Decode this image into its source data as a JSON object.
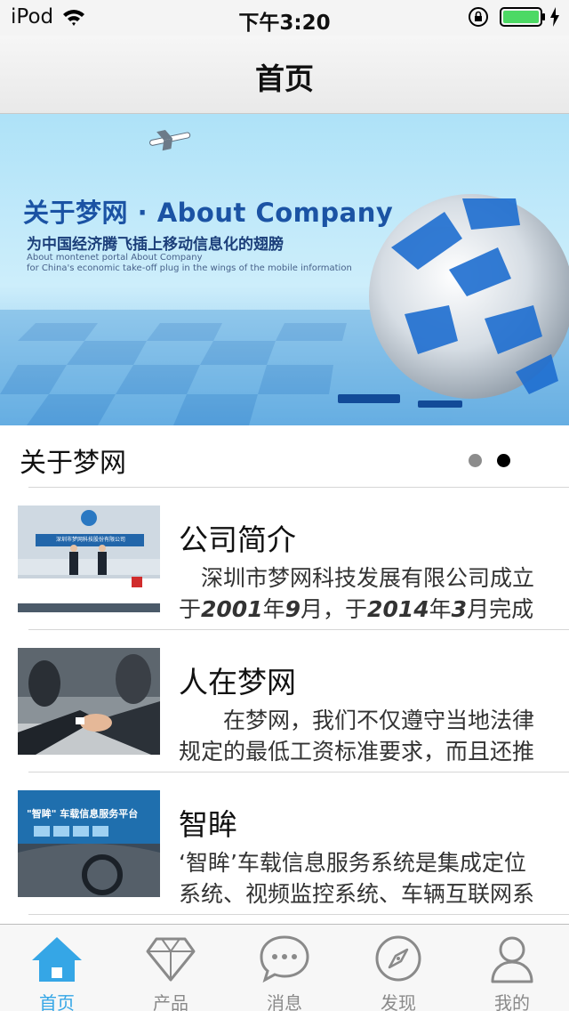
{
  "status_bar": {
    "carrier": "iPod",
    "time": "下午3:20"
  },
  "nav": {
    "title": "首页"
  },
  "banner": {
    "title": "关于梦网 · About Company",
    "subtitle": "为中国经济腾飞插上移动信息化的翅膀",
    "small_line_1": "About montenet portal About Company",
    "small_line_2": "for China's economic take-off plug in the wings of the mobile information",
    "page_count": 2,
    "active_page": 2
  },
  "section": {
    "title": "关于梦网"
  },
  "list": [
    {
      "title": "公司简介",
      "desc_line_1": "　深圳市梦网科技发展有限公司成立",
      "desc_line_2_parts": [
        "于",
        "2001",
        "年",
        "9",
        "月，于",
        "2014",
        "年",
        "3",
        "月完成股"
      ]
    },
    {
      "title": "人在梦网",
      "desc_line_1": "　　在梦网，我们不仅遵守当地法律",
      "desc_line_2": "规定的最低工资标准要求，而且还推"
    },
    {
      "title": "智眸",
      "desc_line_1": "‘智眸’车载信息服务系统是集成定位",
      "desc_line_2": "系统、视频监控系统、车辆互联网系"
    }
  ],
  "thumb_text": {
    "item1_sign": "深圳市梦网科技股份有限公司",
    "item3_title": "\"智眸\" 车载信息服务平台"
  },
  "tabs": [
    {
      "label": "首页",
      "icon": "home-icon",
      "active": true
    },
    {
      "label": "产品",
      "icon": "diamond-icon",
      "active": false
    },
    {
      "label": "消息",
      "icon": "chat-bubble-icon",
      "active": false
    },
    {
      "label": "发现",
      "icon": "compass-icon",
      "active": false
    },
    {
      "label": "我的",
      "icon": "user-icon",
      "active": false
    }
  ],
  "colors": {
    "accent": "#35a6e6",
    "inactive_tab": "#8a8a8a",
    "battery": "#4cd964",
    "banner_blue": "#1b53a4"
  }
}
